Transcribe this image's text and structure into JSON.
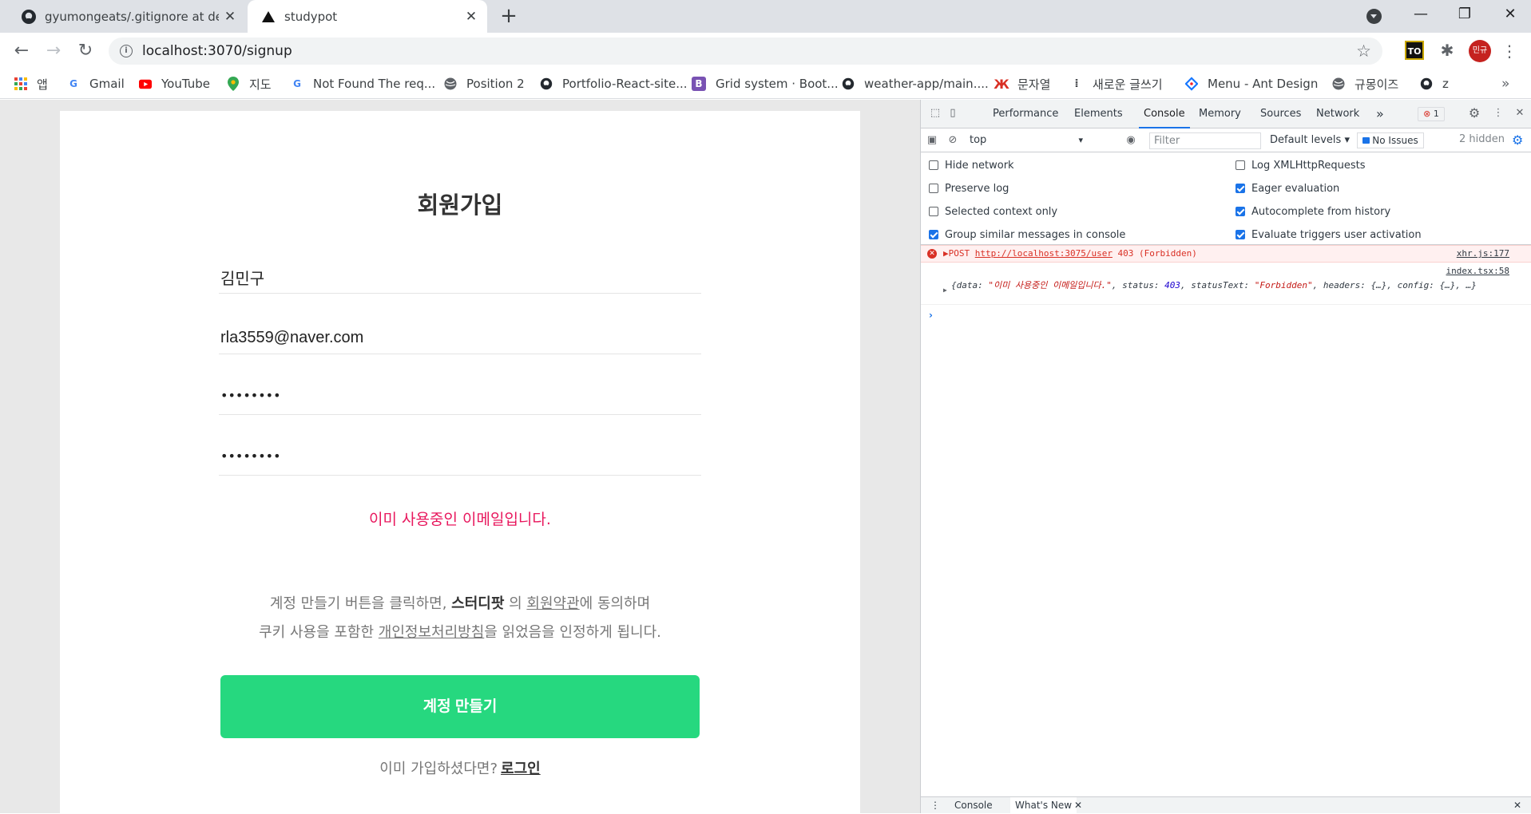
{
  "tabs": [
    {
      "title": "gyumongeats/.gitignore at deve",
      "icon": "github-icon"
    },
    {
      "title": "studypot",
      "icon": "triangle-icon"
    }
  ],
  "toolbar": {
    "url": "localhost:3070/signup",
    "extension_label": "TO",
    "avatar_label": "민규"
  },
  "bookmarks": [
    {
      "label": "앱",
      "icon": "apps-grid-icon"
    },
    {
      "label": "Gmail",
      "icon": "google-icon"
    },
    {
      "label": "YouTube",
      "icon": "youtube-icon"
    },
    {
      "label": "지도",
      "icon": "maps-pin-icon"
    },
    {
      "label": "Not Found The req...",
      "icon": "google-icon"
    },
    {
      "label": "Position 2",
      "icon": "globe-icon"
    },
    {
      "label": "Portfolio-React-site...",
      "icon": "github-icon"
    },
    {
      "label": "Grid system · Boot...",
      "icon": "bootstrap-icon"
    },
    {
      "label": "weather-app/main....",
      "icon": "github-icon"
    },
    {
      "label": "문자열",
      "icon": "antenna-icon"
    },
    {
      "label": "새로운 글쓰기",
      "icon": "dots-icon"
    },
    {
      "label": "Menu - Ant Design",
      "icon": "ant-design-icon"
    },
    {
      "label": "규몽이즈",
      "icon": "globe-icon"
    },
    {
      "label": "z",
      "icon": "github-icon"
    }
  ],
  "signup": {
    "title": "회원가입",
    "name_value": "김민구",
    "email_value": "rla3559@naver.com",
    "password_mask": "••••••••",
    "password_confirm_mask": "••••••••",
    "error_message": "이미 사용중인 이메일입니다.",
    "agree_part1": "계정 만들기 버튼을 클릭하면, ",
    "agree_brand": "스터디팟",
    "agree_part2": " 의 ",
    "agree_terms_link": "회원약관",
    "agree_part3": "에 동의하며",
    "agree_part4": "쿠키 사용을 포함한 ",
    "agree_privacy_link": "개인정보처리방침",
    "agree_part5": "을 읽었음을 인정하게 됩니다.",
    "create_button": "계정 만들기",
    "login_prompt": "이미 가입하셨다면?",
    "login_link": "로그인"
  },
  "devtools": {
    "tabs": [
      "Performance",
      "Elements",
      "Console",
      "Memory",
      "Sources",
      "Network"
    ],
    "more_tabs": "»",
    "error_count": "1",
    "context": "top",
    "filter_placeholder": "Filter",
    "levels": "Default levels ▾",
    "issues": "No Issues",
    "hidden": "2 hidden",
    "options_left": [
      {
        "label": "Hide network",
        "checked": false
      },
      {
        "label": "Preserve log",
        "checked": false
      },
      {
        "label": "Selected context only",
        "checked": false
      },
      {
        "label": "Group similar messages in console",
        "checked": true
      }
    ],
    "options_right": [
      {
        "label": "Log XMLHttpRequests",
        "checked": false
      },
      {
        "label": "Eager evaluation",
        "checked": true
      },
      {
        "label": "Autocomplete from history",
        "checked": true
      },
      {
        "label": "Evaluate triggers user activation",
        "checked": true
      }
    ],
    "error_line": {
      "method": "▶POST ",
      "url": "http://localhost:3075/user",
      "status": " 403 (Forbidden)",
      "source": "xhr.js:177"
    },
    "log_line": {
      "source": "index.tsx:58",
      "p1": "{data: ",
      "data_str": "\"이미 사용중인 이메일입니다.\"",
      "p2": ", status: ",
      "status_num": "403",
      "p3": ", statusText: ",
      "status_text": "\"Forbidden\"",
      "p4": ", headers: {…}, config: {…}, …}"
    },
    "prompt": "›",
    "drawer_tabs": [
      "Console",
      "What's New"
    ]
  },
  "colors": {
    "accent_green": "#26d87f",
    "error_pink": "#e8175d",
    "devtools_blue": "#1a73e8"
  }
}
